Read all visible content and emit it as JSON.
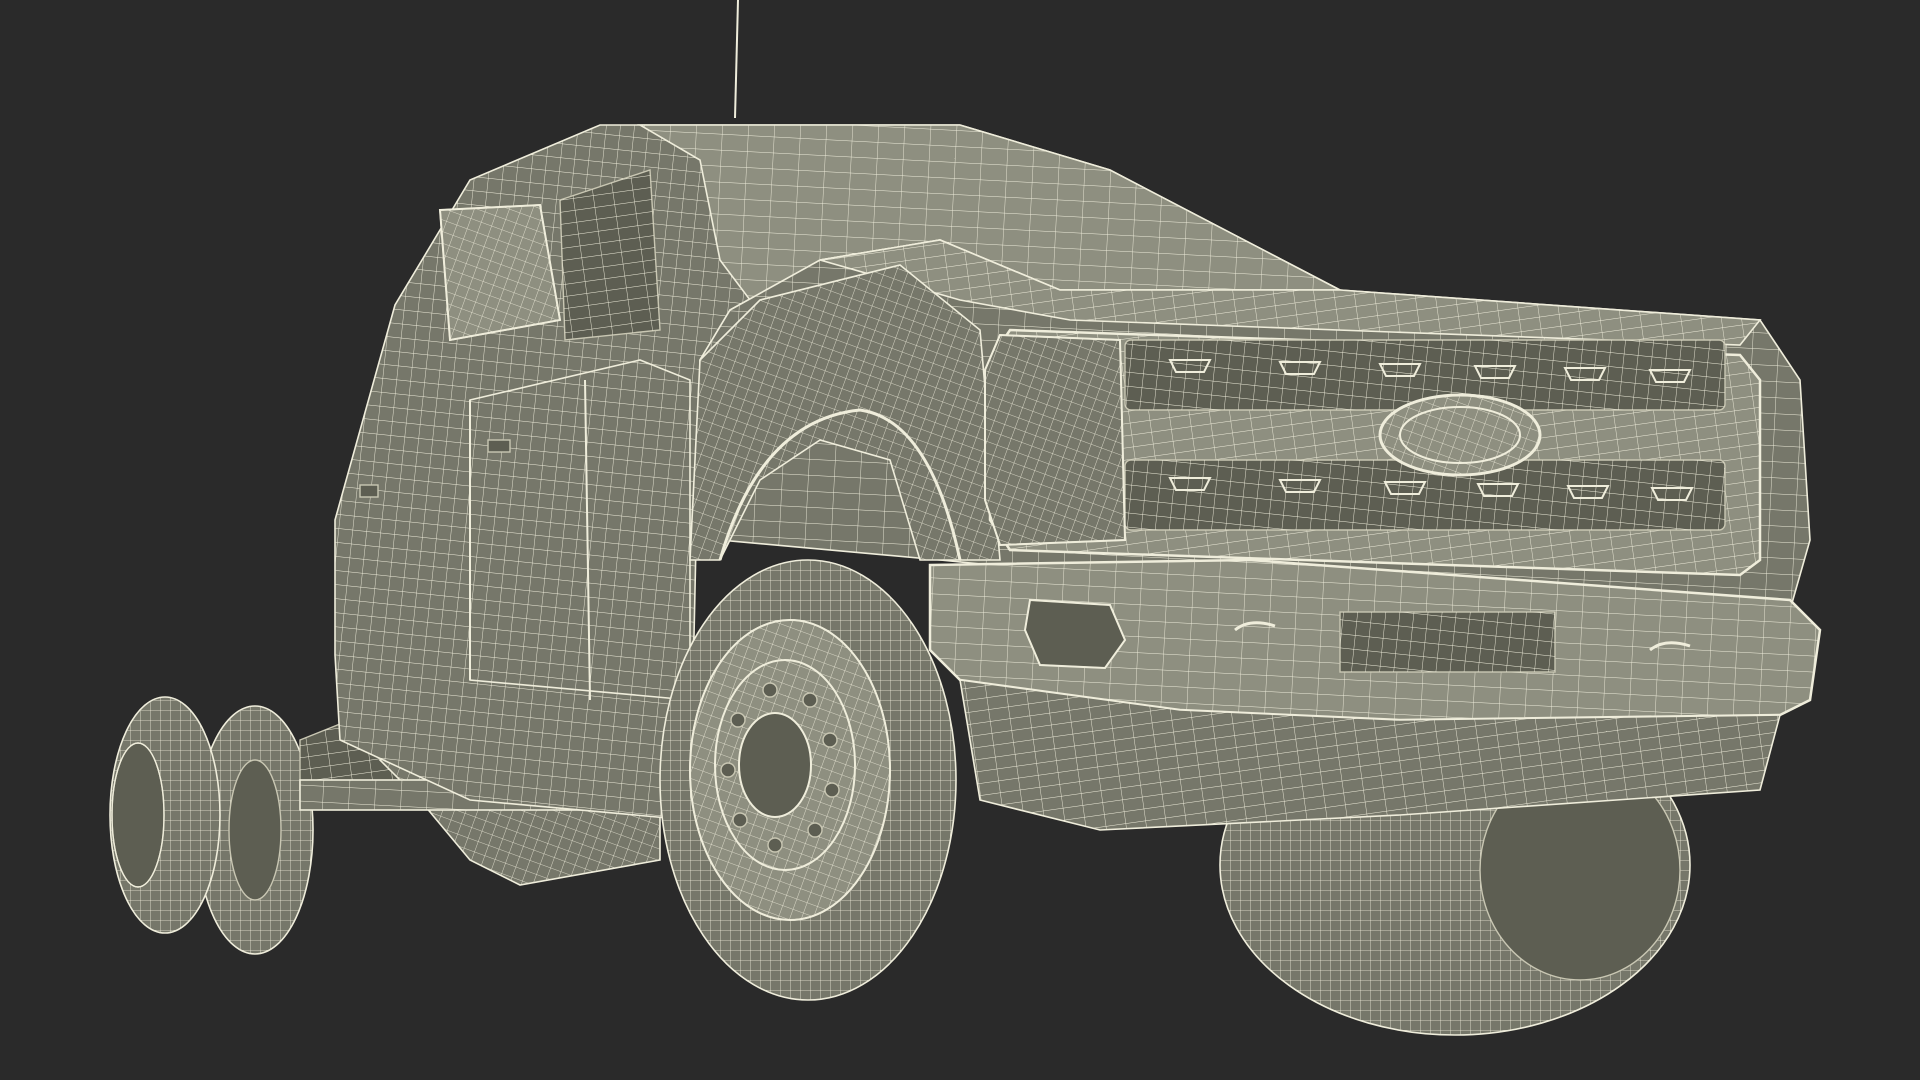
{
  "scene": {
    "subject": "pickup-truck-chassis-cab",
    "render_style": "wireframe",
    "colors": {
      "background": "#2a2a2a",
      "surface": "#76776a",
      "surface_light": "#8e8f80",
      "surface_dark": "#5d5e52",
      "wire": "#efeddb",
      "wire_dim": "#c9c7b3",
      "shadow": "#3e3f37"
    }
  }
}
